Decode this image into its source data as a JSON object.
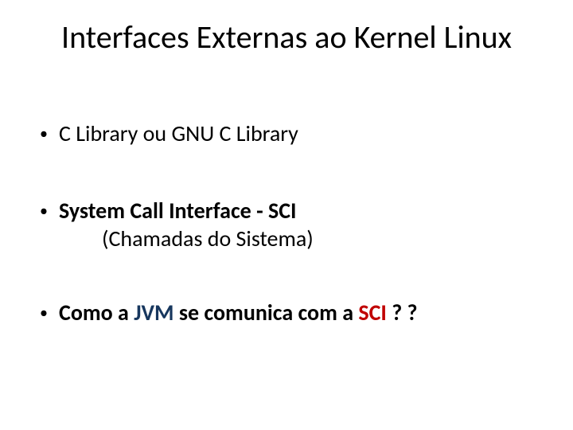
{
  "title": "Interfaces Externas ao Kernel Linux",
  "bullets": {
    "b1": "C Library   ou  GNU C Library",
    "b2": "System Call Interface - SCI",
    "b2_sub": "(Chamadas do Sistema)",
    "b3_pre": "Como a ",
    "b3_jvm": "JVM",
    "b3_mid": " se comunica com a ",
    "b3_sci": "SCI",
    "b3_post": " ? ?"
  }
}
